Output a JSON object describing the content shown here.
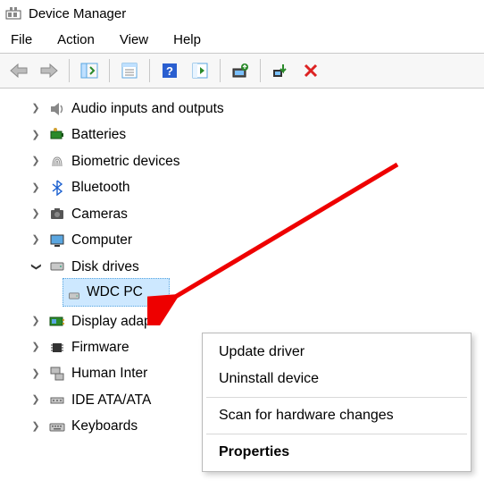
{
  "window": {
    "title": "Device Manager"
  },
  "menu": {
    "file": "File",
    "action": "Action",
    "view": "View",
    "help": "Help"
  },
  "tree": {
    "items": [
      {
        "label": "Audio inputs and outputs",
        "expanded": false
      },
      {
        "label": "Batteries",
        "expanded": false
      },
      {
        "label": "Biometric devices",
        "expanded": false
      },
      {
        "label": "Bluetooth",
        "expanded": false
      },
      {
        "label": "Cameras",
        "expanded": false
      },
      {
        "label": "Computer",
        "expanded": false
      },
      {
        "label": "Disk drives",
        "expanded": true,
        "children": [
          {
            "label": "WDC PC"
          }
        ]
      },
      {
        "label": "Display adap",
        "expanded": false
      },
      {
        "label": "Firmware",
        "expanded": false
      },
      {
        "label": "Human Inter",
        "expanded": false
      },
      {
        "label": "IDE ATA/ATA",
        "expanded": false
      },
      {
        "label": "Keyboards",
        "expanded": false
      }
    ]
  },
  "context_menu": {
    "update": "Update driver",
    "uninstall": "Uninstall device",
    "scan": "Scan for hardware changes",
    "properties": "Properties"
  }
}
